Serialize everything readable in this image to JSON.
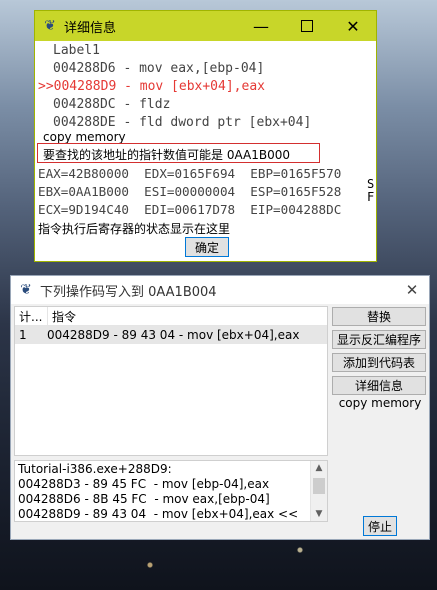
{
  "detail_window": {
    "title": "详细信息",
    "asm_lines": [
      "Label1",
      "004288D6 - mov eax,[ebp-04]",
      ">>004288D9 - mov [ebx+04],eax",
      "004288DC - fldz",
      "004288DE - fld dword ptr [ebx+04]"
    ],
    "copy_memory": "copy memory",
    "pointer_hint": "要查找的该地址的指针数值可能是 0AA1B000",
    "registers": [
      "EAX=42B80000  EDX=0165F694  EBP=0165F570",
      "EBX=0AA1B000  ESI=00000004  ESP=0165F528",
      "ECX=9D194C40  EDI=00617D78  EIP=004288DC"
    ],
    "side_flags": [
      "S",
      "F"
    ],
    "note": "指令执行后寄存器的状态显示在这里",
    "ok_label": "确定"
  },
  "writes_window": {
    "title": "下列操作码写入到 0AA1B004",
    "columns": [
      "计...",
      "指令"
    ],
    "rows": [
      {
        "count": "1",
        "instruction": "004288D9 - 89 43 04  - mov [ebx+04],eax"
      }
    ],
    "buttons": {
      "replace": "替换",
      "show_disassembler": "显示反汇编程序",
      "add_to_codelist": "添加到代码表",
      "more_info": "详细信息",
      "stop": "停止"
    },
    "copy_memory": "copy memory",
    "trace_lines": [
      "Tutorial-i386.exe+288D9:",
      "004288D3 - 89 45 FC  - mov [ebp-04],eax",
      "004288D6 - 8B 45 FC  - mov eax,[ebp-04]",
      "004288D9 - 89 43 04  - mov [ebx+04],eax <<"
    ]
  },
  "colors": {
    "detail_titlebar": "#c8d629",
    "highlight_red": "#e53935",
    "box_border": "#d32f2f"
  }
}
